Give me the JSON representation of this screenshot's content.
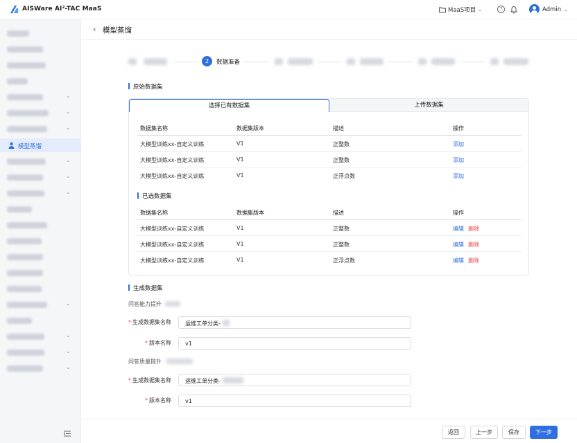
{
  "app": {
    "title": "AISWare AI²-TAC MaaS"
  },
  "topbar": {
    "project": "MaaS项目",
    "user": "Admin"
  },
  "sidebar": {
    "active_label": "模型蒸馏"
  },
  "page": {
    "title": "模型蒸馏"
  },
  "steps": {
    "current_number": "2",
    "current_label": "数据准备"
  },
  "original_dataset": {
    "title": "原始数据集",
    "tabs": [
      "选择已有数据集",
      "上传数据集"
    ],
    "columns": [
      "数据集名称",
      "数据集版本",
      "描述",
      "操作"
    ],
    "available_rows": [
      {
        "name": "大模型训练xx-自定义训练",
        "version": "V1",
        "desc": "正整数",
        "action": "添加"
      },
      {
        "name": "大模型训练xx-自定义训练",
        "version": "V1",
        "desc": "正整数",
        "action": "添加"
      },
      {
        "name": "大模型训练xx-自定义训练",
        "version": "V1",
        "desc": "正浮点数",
        "action": "添加"
      }
    ],
    "selected_title": "已选数据集",
    "selected_rows": [
      {
        "name": "大模型训练xx-自定义训练",
        "version": "V1",
        "desc": "正整数",
        "edit": "编辑",
        "delete": "删除"
      },
      {
        "name": "大模型训练xx-自定义训练",
        "version": "V1",
        "desc": "正整数",
        "edit": "编辑",
        "delete": "删除"
      },
      {
        "name": "大模型训练xx-自定义训练",
        "version": "V1",
        "desc": "正浮点数",
        "edit": "编辑",
        "delete": "删除"
      }
    ]
  },
  "generate": {
    "title": "生成数据集",
    "groups": [
      {
        "title": "问答能力提升",
        "name_label": "生成数据集名称",
        "name_value": "运维工单分类-",
        "version_label": "版本名称",
        "version_value": "v1"
      },
      {
        "title": "问答质量提升",
        "name_label": "生成数据集名称",
        "name_value": "运维工单分类-",
        "version_label": "版本名称",
        "version_value": "v1"
      }
    ]
  },
  "footer": {
    "back": "返回",
    "prev": "上一步",
    "save": "保存",
    "next": "下一步"
  },
  "colors": {
    "primary": "#2f6fe0",
    "danger": "#e5484d",
    "sidebar_bg": "#f5f6f8"
  }
}
